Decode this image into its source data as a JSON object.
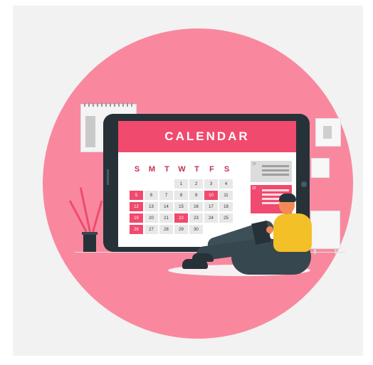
{
  "calendar": {
    "title": "CALENDAR",
    "days_of_week": [
      "S",
      "M",
      "T",
      "W",
      "T",
      "F",
      "S"
    ],
    "weeks": [
      [
        "",
        "",
        "",
        "1",
        "2",
        "3",
        "4"
      ],
      [
        "5",
        "6",
        "7",
        "8",
        "9",
        "10",
        "11"
      ],
      [
        "12",
        "13",
        "14",
        "15",
        "16",
        "17",
        "18"
      ],
      [
        "19",
        "20",
        "21",
        "22",
        "23",
        "24",
        "25"
      ],
      [
        "26",
        "27",
        "28",
        "29",
        "30",
        "",
        ""
      ]
    ],
    "highlighted_days": [
      "5",
      "10",
      "12",
      "19",
      "22",
      "26"
    ],
    "side_card_numbers": [
      "19",
      "22"
    ]
  },
  "colors": {
    "accent": "#f04a6e",
    "circle": "#f9889f",
    "device": "#263238",
    "shirt": "#f3c028"
  },
  "icons": [
    "calendar-illustration",
    "plant-icon",
    "person-reading-icon"
  ]
}
